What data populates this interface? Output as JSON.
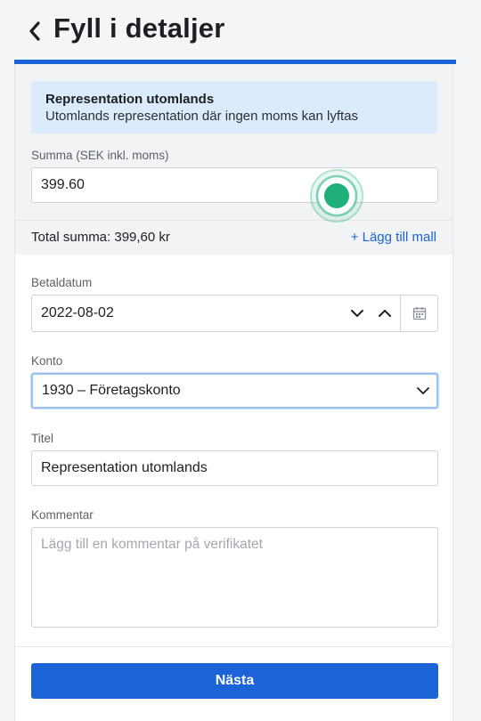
{
  "header": {
    "back_icon": "chevron-left-icon",
    "title": "Fyll i detaljer"
  },
  "info": {
    "title": "Representation utomlands",
    "subtitle": "Utomlands representation där ingen moms kan lyftas"
  },
  "amount": {
    "label": "Summa (SEK inkl. moms)",
    "value": "399.60"
  },
  "total": {
    "text": "Total summa: 399,60 kr",
    "add_template_label": "+ Lägg till mall"
  },
  "payment_date": {
    "label": "Betaldatum",
    "value": "2022-08-02",
    "icons": [
      "chevron-down-icon",
      "chevron-up-icon",
      "calendar-icon"
    ]
  },
  "account": {
    "label": "Konto",
    "value": "1930 – Företagskonto"
  },
  "title_field": {
    "label": "Titel",
    "value": "Representation utomlands"
  },
  "comment": {
    "label": "Kommentar",
    "placeholder": "Lägg till en kommentar på verifikatet"
  },
  "next_button": {
    "label": "Nästa"
  },
  "colors": {
    "accent": "#1b63d6",
    "info_bg": "#dcebfb",
    "tap_indicator": "#1fb07a"
  }
}
